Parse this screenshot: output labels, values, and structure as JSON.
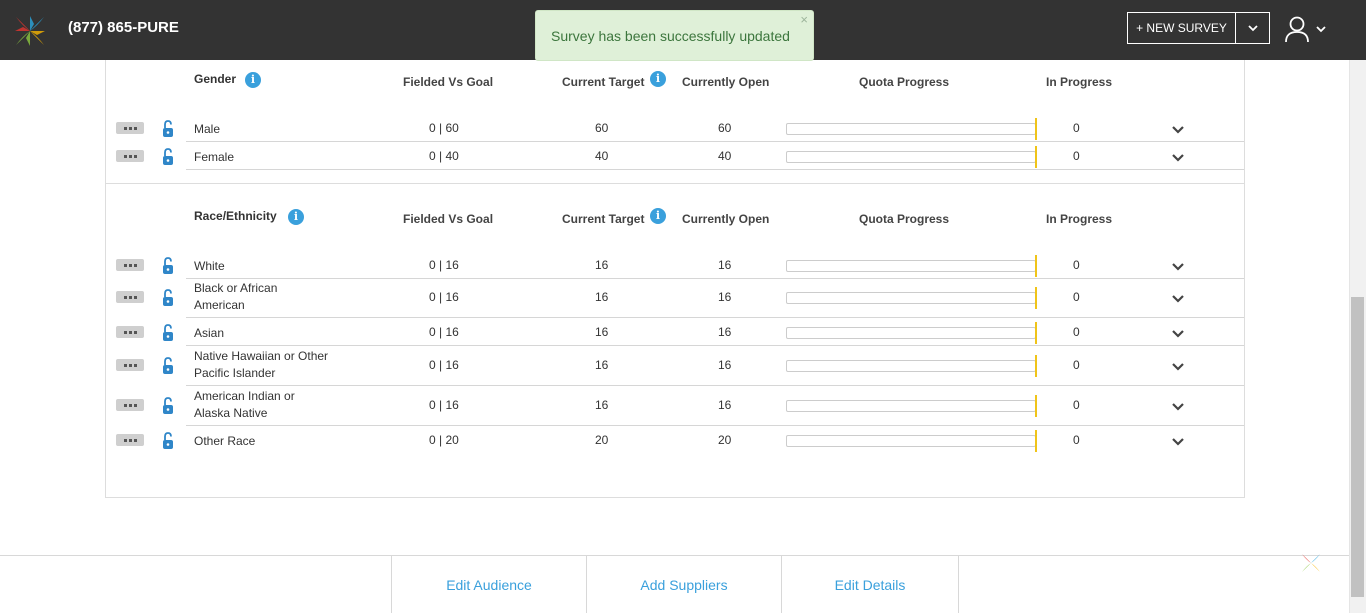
{
  "header": {
    "phone": "(877) 865-PURE",
    "new_survey_label": "+ NEW SURVEY"
  },
  "toast": {
    "message": "Survey has been successfully updated",
    "close": "×"
  },
  "columns": {
    "fielded": "Fielded Vs Goal",
    "target": "Current Target",
    "open": "Currently Open",
    "progress": "Quota Progress",
    "in_progress": "In Progress"
  },
  "sections": [
    {
      "title": "Gender",
      "rows": [
        {
          "name": "Male",
          "fielded": "0 | 60",
          "target": "60",
          "open": "60",
          "in_progress": "0"
        },
        {
          "name": "Female",
          "fielded": "0 | 40",
          "target": "40",
          "open": "40",
          "in_progress": "0"
        }
      ]
    },
    {
      "title": "Race/Ethnicity",
      "rows": [
        {
          "name": "White",
          "fielded": "0 | 16",
          "target": "16",
          "open": "16",
          "in_progress": "0"
        },
        {
          "name": "Black or African American",
          "fielded": "0 | 16",
          "target": "16",
          "open": "16",
          "in_progress": "0"
        },
        {
          "name": "Asian",
          "fielded": "0 | 16",
          "target": "16",
          "open": "16",
          "in_progress": "0"
        },
        {
          "name": "Native Hawaiian or Other Pacific Islander",
          "fielded": "0 | 16",
          "target": "16",
          "open": "16",
          "in_progress": "0"
        },
        {
          "name": "American Indian or Alaska Native",
          "fielded": "0 | 16",
          "target": "16",
          "open": "16",
          "in_progress": "0"
        },
        {
          "name": "Other Race",
          "fielded": "0 | 20",
          "target": "20",
          "open": "20",
          "in_progress": "0"
        }
      ]
    }
  ],
  "quota_progress": [
    0,
    0,
    0,
    0,
    0,
    0,
    0,
    0
  ],
  "footer": {
    "tabs": [
      "Edit Audience",
      "Add Suppliers",
      "Edit Details"
    ]
  },
  "colors": {
    "topbar": "#333333",
    "accent": "#3aa0dc",
    "toast_bg": "#dff0d8",
    "toast_text": "#3c763d",
    "progress_marker": "#f0c419"
  },
  "icons": {
    "logo": "pure-spectrum-logo",
    "info": "info-icon",
    "lock": "lock-icon",
    "more": "more-dots-icon",
    "expand": "chevron-down-icon",
    "user": "user-icon"
  }
}
